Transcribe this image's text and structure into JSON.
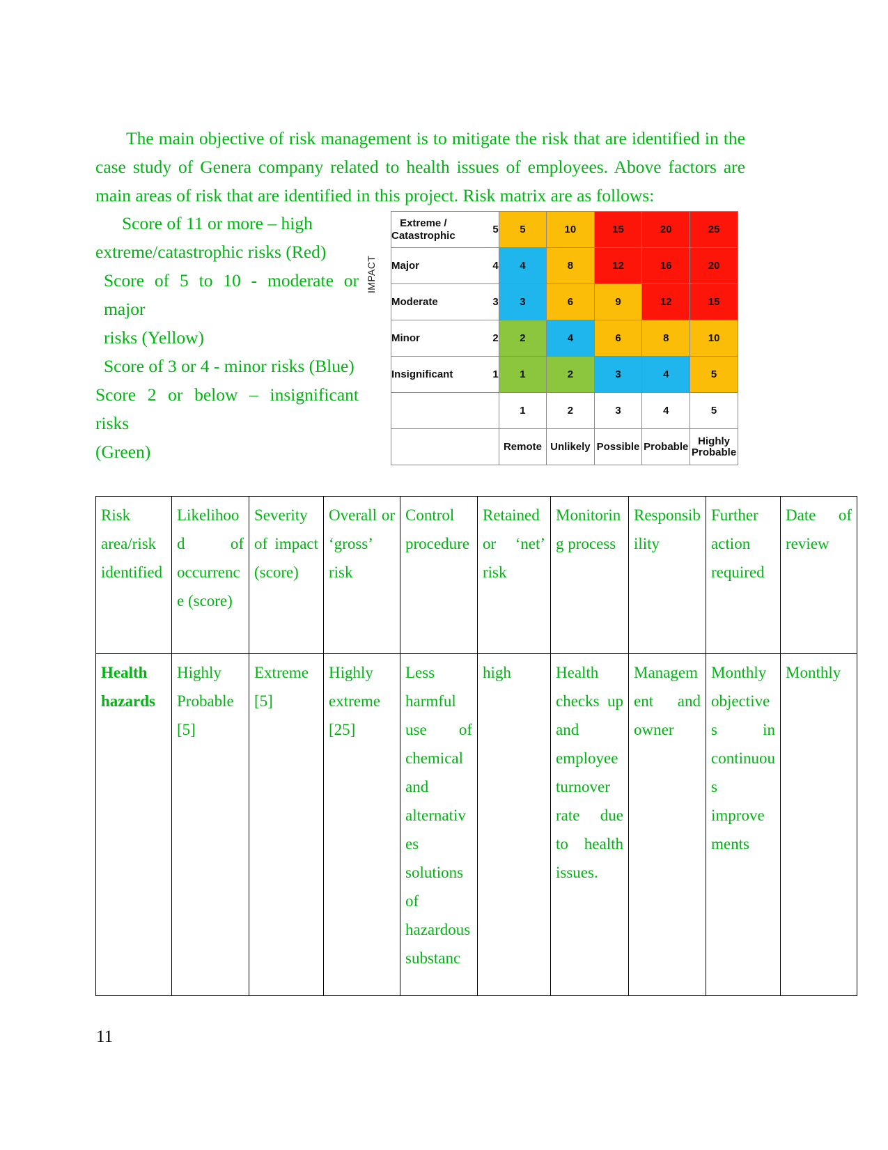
{
  "document": {
    "page_number": "11",
    "intro_paragraph": "The main objective of risk management is to mitigate the risk that are identified in the case study of Genera company related to health issues of employees. Above factors are main areas of risk that are identified in this project. Risk matrix are as follows:",
    "text_color": "#00b512",
    "score_legend": [
      "Score of 11 or more – high extreme/catastrophic risks (Red)",
      "Score of 5 to 10 - moderate or major risks (Yellow)",
      "Score of 3 or 4 - minor risks (Blue)",
      "Score 2 or below – insignificant risks (Green)"
    ],
    "score_legend_lines": [
      "Score of 11 or more – high",
      "extreme/catastrophic risks (Red)",
      "Score of 5 to 10 - moderate or major",
      "risks (Yellow)",
      "Score of 3 or 4 - minor risks (Blue)",
      "Score 2 or below – insignificant risks",
      "(Green)"
    ]
  },
  "chart_data": {
    "type": "heatmap",
    "title": "Risk Matrix",
    "ylabel": "IMPACT",
    "xlabel": "",
    "grid": true,
    "legend_position": "none",
    "y_categories": [
      {
        "label": "Extreme /\nCatastrophic",
        "score": "5"
      },
      {
        "label": "Major",
        "score": "4"
      },
      {
        "label": "Moderate",
        "score": "3"
      },
      {
        "label": "Minor",
        "score": "2"
      },
      {
        "label": "Insignificant",
        "score": "1"
      }
    ],
    "x_categories": [
      {
        "num": "1",
        "label": "Remote"
      },
      {
        "num": "2",
        "label": "Unlikely"
      },
      {
        "num": "3",
        "label": "Possible"
      },
      {
        "num": "4",
        "label": "Probable"
      },
      {
        "num": "5",
        "label": "Highly\nProbable"
      }
    ],
    "rows": [
      {
        "impact": "Extreme / Catastrophic",
        "cells": [
          {
            "value": "5",
            "color": "#fbbd08"
          },
          {
            "value": "10",
            "color": "#fbbd08"
          },
          {
            "value": "15",
            "color": "#fc1508"
          },
          {
            "value": "20",
            "color": "#fc1508"
          },
          {
            "value": "25",
            "color": "#fc1508"
          }
        ]
      },
      {
        "impact": "Major",
        "cells": [
          {
            "value": "4",
            "color": "#1fb6ed"
          },
          {
            "value": "8",
            "color": "#fbbd08"
          },
          {
            "value": "12",
            "color": "#fc1508"
          },
          {
            "value": "16",
            "color": "#fc1508"
          },
          {
            "value": "20",
            "color": "#fc1508"
          }
        ]
      },
      {
        "impact": "Moderate",
        "cells": [
          {
            "value": "3",
            "color": "#1fb6ed"
          },
          {
            "value": "6",
            "color": "#fbbd08"
          },
          {
            "value": "9",
            "color": "#fbbd08"
          },
          {
            "value": "12",
            "color": "#fc1508"
          },
          {
            "value": "15",
            "color": "#fc1508"
          }
        ]
      },
      {
        "impact": "Minor",
        "cells": [
          {
            "value": "2",
            "color": "#8cc63e"
          },
          {
            "value": "4",
            "color": "#1fb6ed"
          },
          {
            "value": "6",
            "color": "#fbbd08"
          },
          {
            "value": "8",
            "color": "#fbbd08"
          },
          {
            "value": "10",
            "color": "#fbbd08"
          }
        ]
      },
      {
        "impact": "Insignificant",
        "cells": [
          {
            "value": "1",
            "color": "#8cc63e"
          },
          {
            "value": "2",
            "color": "#8cc63e"
          },
          {
            "value": "3",
            "color": "#1fb6ed"
          },
          {
            "value": "4",
            "color": "#1fb6ed"
          },
          {
            "value": "5",
            "color": "#fbbd08"
          }
        ]
      }
    ],
    "colors": {
      "green": "#8cc63e",
      "blue": "#1fb6ed",
      "yellow": "#fbbd08",
      "red": "#fc1508"
    }
  },
  "risk_table": {
    "headers": [
      "Risk area/risk identified",
      "Likelihood of occurrence (score)",
      "Severity of impact (score)",
      "Overall or ‘gross’ risk",
      "Control procedure",
      "Retained or ‘net’ risk",
      "Monitoring process",
      "Responsibility",
      "Further action required",
      "Date of review"
    ],
    "rows": [
      {
        "risk_area": "Health hazards",
        "likelihood": "Highly Probable [5]",
        "severity": "Extreme [5]",
        "overall": "Highly extreme [25]",
        "control": "Less harmful use of chemical and alternatives solutions of hazardous substanc",
        "retained": "high",
        "monitoring": "Health checks up and employee turnover rate due to health issues.",
        "responsibility": "Management and owner",
        "further_action": "Monthly objectives in continuous improvements",
        "date_review": "Monthly"
      }
    ]
  }
}
